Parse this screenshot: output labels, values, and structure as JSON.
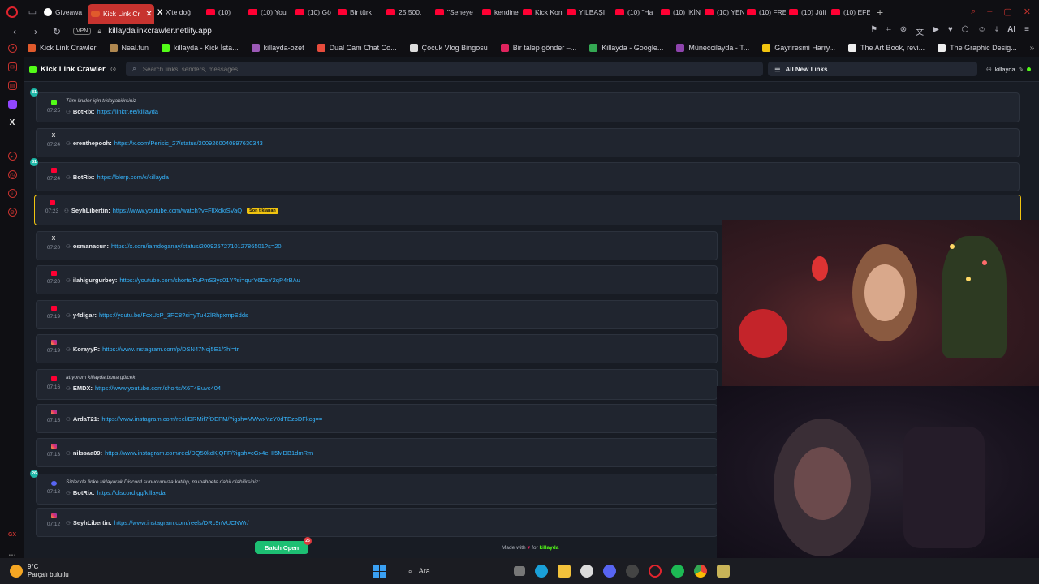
{
  "browser": {
    "tabs": [
      {
        "label": "Giveawa",
        "icon": "gift",
        "active": false
      },
      {
        "label": "Kick Link Cr",
        "icon": "kick",
        "active": true
      },
      {
        "label": "X'te doğ",
        "icon": "x",
        "active": false
      },
      {
        "label": "(10)",
        "icon": "youtube",
        "active": false
      },
      {
        "label": "(10) You",
        "icon": "youtube",
        "active": false
      },
      {
        "label": "(10) Gö",
        "icon": "youtube",
        "active": false
      },
      {
        "label": "Bir türk",
        "icon": "youtube",
        "active": false
      },
      {
        "label": "25.500.",
        "icon": "youtube",
        "active": false
      },
      {
        "label": "\"Seneye",
        "icon": "youtube",
        "active": false
      },
      {
        "label": "kendine",
        "icon": "youtube",
        "active": false
      },
      {
        "label": "Kick Kon",
        "icon": "youtube",
        "active": false
      },
      {
        "label": "YILBAŞI",
        "icon": "youtube",
        "active": false
      },
      {
        "label": "(10) \"Ha",
        "icon": "youtube",
        "active": false
      },
      {
        "label": "(10) İKİN",
        "icon": "youtube",
        "active": false
      },
      {
        "label": "(10) YEN",
        "icon": "youtube",
        "active": false
      },
      {
        "label": "(10) FRE",
        "icon": "youtube",
        "active": false
      },
      {
        "label": "(10) Jüli",
        "icon": "youtube",
        "active": false
      },
      {
        "label": "(10) EFE",
        "icon": "youtube",
        "active": false
      }
    ],
    "vpn_label": "VPN",
    "url": "killaydalinkcrawler.netlify.app",
    "ai_label": "AI",
    "bookmarks": [
      {
        "label": "Kick Link Crawler",
        "color": "#e05a2c"
      },
      {
        "label": "Neal.fun",
        "color": "#b08850"
      },
      {
        "label": "killayda - Kick İsta...",
        "color": "#53fc18"
      },
      {
        "label": "killayda-ozet",
        "color": "#9b59b6"
      },
      {
        "label": "Dual Cam Chat Co...",
        "color": "#e74c3c"
      },
      {
        "label": "Çocuk Vlog Bingosu",
        "color": "#dddddd"
      },
      {
        "label": "Bir talep gönder –...",
        "color": "#e0245e"
      },
      {
        "label": "Killayda - Google...",
        "color": "#34a853"
      },
      {
        "label": "Müneccilayda - T...",
        "color": "#8e44ad"
      },
      {
        "label": "Gayriresmi Harry...",
        "color": "#f1c40f"
      },
      {
        "label": "The Art Book, revi...",
        "color": "#eeeeee"
      },
      {
        "label": "The Graphic Desig...",
        "color": "#eeeeee"
      }
    ]
  },
  "app": {
    "title": "Kick Link Crawler",
    "search_placeholder": "Search links, senders, messages...",
    "filter_label": "All New Links",
    "username": "killayda",
    "clicked_badge": "Son tıklanan",
    "messages": [
      {
        "platform": "kick",
        "time": "07:25",
        "badge": "81",
        "sub": "Tüm linkler için tıklayabilirsiniz",
        "sender": "BotRix:",
        "link": "https://linktr.ee/killayda",
        "clicked": false
      },
      {
        "platform": "x",
        "time": "07:24",
        "badge": "",
        "sub": "",
        "sender": "erenthepooh:",
        "link": "https://x.com/Perisic_27/status/2009260040897630343",
        "clicked": false
      },
      {
        "platform": "blerp",
        "time": "07:24",
        "badge": "81",
        "sub": "",
        "sender": "BotRix:",
        "link": "https://blerp.com/x/killayda",
        "clicked": false
      },
      {
        "platform": "youtube",
        "time": "07:23",
        "badge": "",
        "sub": "",
        "sender": "SeyhLibertin:",
        "link": "https://www.youtube.com/watch?v=FllXdkiSVaQ",
        "clicked": true
      },
      {
        "platform": "x",
        "time": "07:20",
        "badge": "",
        "sub": "",
        "sender": "osmanacun:",
        "link": "https://x.com/iamdoganay/status/2009257271012786501?s=20",
        "clicked": false
      },
      {
        "platform": "youtube",
        "time": "07:20",
        "badge": "",
        "sub": "",
        "sender": "ilahigurgurbey:",
        "link": "https://youtube.com/shorts/FuPmS3yc01Y?si=qurY6DsY2qP4rBAu",
        "clicked": false
      },
      {
        "platform": "youtube",
        "time": "07:19",
        "badge": "",
        "sub": "",
        "sender": "y4digar:",
        "link": "https://youtu.be/FcxUcP_3FC8?si=yTu4ZlRhpxmpSdds",
        "clicked": false
      },
      {
        "platform": "instagram",
        "time": "07:19",
        "badge": "",
        "sub": "",
        "sender": "KorayyR:",
        "link": "https://www.instagram.com/p/DSN47Noj5E1/?hl=tr",
        "clicked": false
      },
      {
        "platform": "youtube",
        "time": "07:16",
        "badge": "",
        "sub": "atıyorum killayda buna gülcek",
        "sender": "EMDX:",
        "link": "https://www.youtube.com/shorts/X6T4Buvc404",
        "clicked": false
      },
      {
        "platform": "instagram",
        "time": "07:15",
        "badge": "",
        "sub": "",
        "sender": "ArdaT21:",
        "link": "https://www.instagram.com/reel/DRMif7fDEPM/?igsh=MWwxYzY0dTEzbDFkcg==",
        "clicked": false
      },
      {
        "platform": "instagram",
        "time": "07:13",
        "badge": "",
        "sub": "",
        "sender": "nilssaa09:",
        "link": "https://www.instagram.com/reel/DQ50kdKjQFF/?igsh=cGx4eHI5MDB1dmRm",
        "clicked": false
      },
      {
        "platform": "discord",
        "time": "07:13",
        "badge": "26",
        "sub": "Sizler de linke tıklayarak Discord sunucumuza katılıp, muhabbete dahil olabilirsiniz:",
        "sender": "BotRix:",
        "link": "https://discord.gg/killayda",
        "clicked": false
      },
      {
        "platform": "instagram",
        "time": "07:12",
        "badge": "",
        "sub": "",
        "sender": "SeyhLibertin:",
        "link": "https://www.instagram.com/reels/DRc9nVUCNWr/",
        "clicked": false
      }
    ],
    "batch_label": "Batch Open",
    "batch_count": "25",
    "made_with": "Made with",
    "made_for": "for",
    "made_user": "killayda"
  },
  "taskbar": {
    "temperature": "9°C",
    "weather": "Parçalı bulutlu",
    "search_label": "Ara"
  }
}
